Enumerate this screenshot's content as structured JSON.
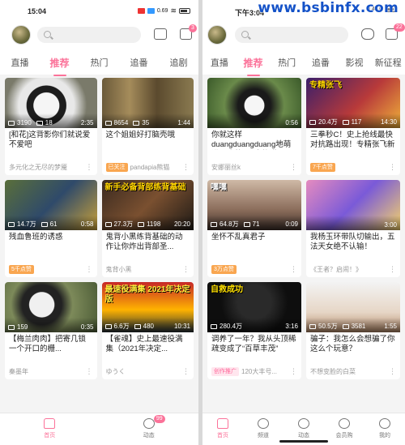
{
  "watermark": "www.bsbinfx.com",
  "left": {
    "status_time": "15:04",
    "status_misc": "0.69",
    "mail_badge": "3",
    "tabs": [
      "直播",
      "推荐",
      "热门",
      "追番",
      "追剧"
    ],
    "active_tab": 1,
    "cards": [
      {
        "plays": "3190",
        "danmaku": "18",
        "duration": "2:35",
        "title": "[和花]这背影你们就说爱不爱吧",
        "meta": "多元化之无尽的梦魇",
        "tag": ""
      },
      {
        "plays": "8654",
        "danmaku": "35",
        "duration": "1:44",
        "title": "这个姐姐好打脑壳哦",
        "meta": "pandapia熊猫",
        "tag": "已关注"
      },
      {
        "plays": "14.7万",
        "danmaku": "61",
        "duration": "0:58",
        "title": "残血鲁班的诱惑",
        "meta": "",
        "tag": "5千点赞"
      },
      {
        "plays": "27.3万",
        "danmaku": "1198",
        "duration": "20:20",
        "title": "鬼背小黑练背基础的动作让你炸出背部圣...",
        "meta": "鬼背小黑",
        "tag": "",
        "overlay": "新手必备背部练背基础"
      },
      {
        "plays": "159",
        "danmaku": "",
        "duration": "0:35",
        "title": "【梅兰肉肉】把寄几锁 一个开口的栅...",
        "meta": "秦墨年",
        "tag": ""
      },
      {
        "plays": "6.6万",
        "danmaku": "480",
        "duration": "10:31",
        "title": "【雀魂】史上最速役满集（2021年决定...",
        "meta": "ゆうく",
        "tag": "",
        "overlay": "最速役满集 2021年决定版"
      }
    ],
    "nav": [
      {
        "label": "首页"
      },
      {
        "label": "动态",
        "badge": "99"
      }
    ]
  },
  "right": {
    "status_time": "下午3:04",
    "status_misc": "0.4K/s",
    "mail_badge": "22",
    "tabs": [
      "直播",
      "推荐",
      "热门",
      "追番",
      "影视",
      "新征程"
    ],
    "active_tab": 1,
    "cards": [
      {
        "plays": "",
        "danmaku": "",
        "duration": "0:56",
        "title": "你就这样duangduangduang地萌进了我的心![大熊猫...",
        "meta": "安娜丽丝k",
        "tag": ""
      },
      {
        "plays": "20.4万",
        "danmaku": "117",
        "duration": "14:30",
        "title": "三拳秒C！史上抢线最快对抗路出现！专精张飞新赛季飞飞",
        "meta": "",
        "tag": "7千点赞",
        "overlay": "专精张飞"
      },
      {
        "plays": "64.8万",
        "danmaku": "71",
        "duration": "0:09",
        "title": "坐怀不乱真君子",
        "meta": "",
        "tag": "3万点赞",
        "overlay": "嘿嘿"
      },
      {
        "plays": "",
        "danmaku": "",
        "duration": "3:00",
        "title": "我杨玉环带队切输出，五法天女绝不认输！",
        "meta": "《王者？启闹！》",
        "tag": ""
      },
      {
        "plays": "280.4万",
        "danmaku": "",
        "duration": "3:16",
        "title": "调养了一年？我从头顶稀疏变成了“百草丰茂”",
        "meta": "120大丰号...",
        "tag": "创作推广",
        "overlay": "自救成功"
      },
      {
        "plays": "50.5万",
        "danmaku": "3581",
        "duration": "1:55",
        "title": "骗子：我怎么会想骗了你这么个玩意？",
        "meta": "不想变脸的白菜",
        "tag": ""
      }
    ],
    "nav": [
      {
        "label": "首页"
      },
      {
        "label": "频道"
      },
      {
        "label": "动态"
      },
      {
        "label": "会员购"
      },
      {
        "label": "我的"
      }
    ]
  }
}
